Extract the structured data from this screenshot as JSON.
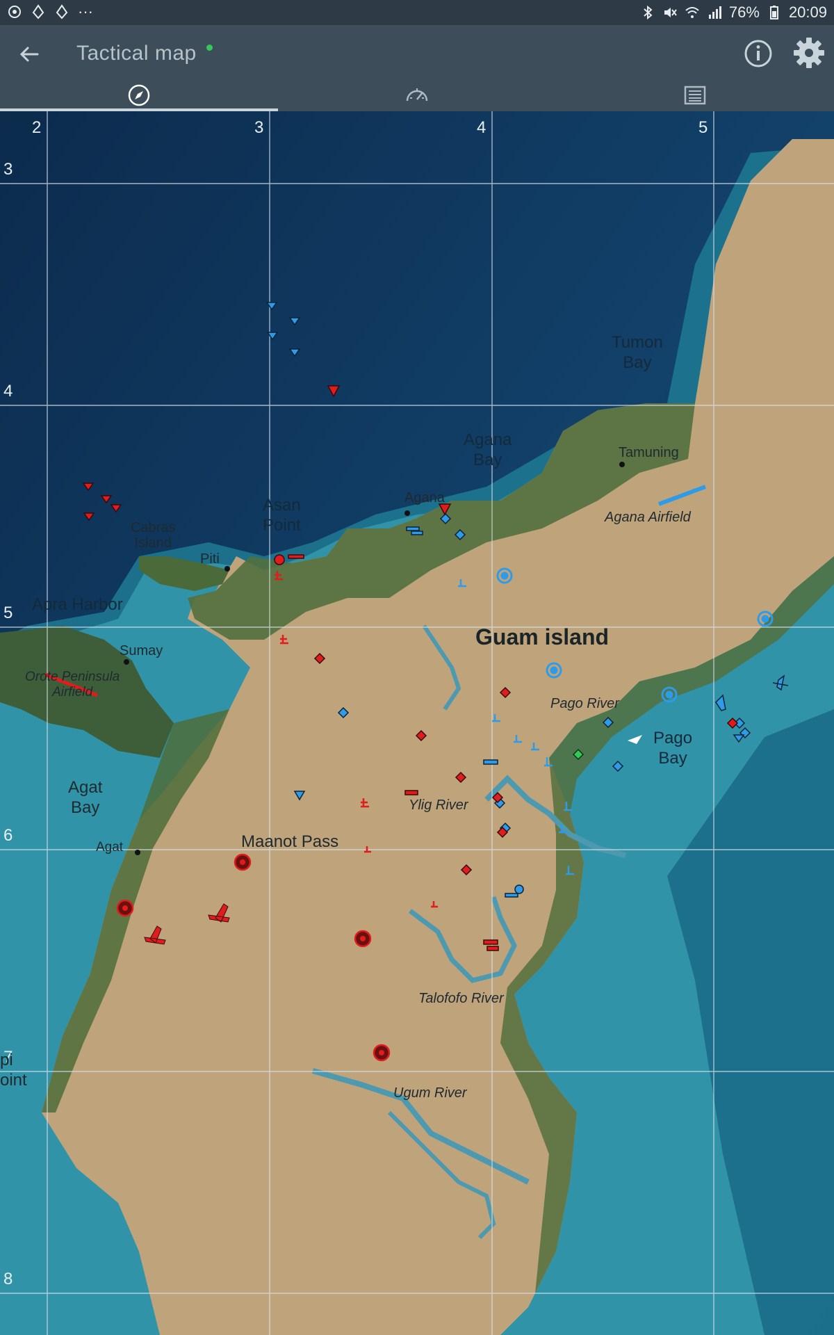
{
  "status_bar": {
    "battery": "76%",
    "time": "20:09",
    "overflow": "···",
    "left_icons": [
      "sync-icon",
      "app-icon",
      "app-icon"
    ],
    "right_icons": [
      "bluetooth-icon",
      "mute-icon",
      "wifi-icon",
      "signal-icon",
      "battery-icon"
    ]
  },
  "app_bar": {
    "title": "Tactical map",
    "status_dot_color": "#34c759",
    "actions": [
      "info-icon",
      "settings-gear-icon"
    ]
  },
  "tabs": [
    {
      "icon": "compass-icon",
      "selected": true
    },
    {
      "icon": "speedometer-icon",
      "selected": false
    },
    {
      "icon": "list-icon",
      "selected": false
    }
  ],
  "map": {
    "grid_columns": [
      "2",
      "3",
      "4",
      "5"
    ],
    "grid_rows": [
      "3",
      "4",
      "5",
      "6",
      "7",
      "8"
    ],
    "labels": {
      "tumon_bay": "Tumon\nBay",
      "agana_bay": "Agana\nBay",
      "tamuning": "Tamuning",
      "agana_airfield": "Agana Airfield",
      "asan_point": "Asan\nPoint",
      "agana": "Agana",
      "cabras_island": "Cabras\nIsland",
      "piti": "Piti",
      "apra_harbor": "Apra Harbor",
      "sumay": "Sumay",
      "orote_airfield": "Orote Peninsula\nAirfield",
      "guam_island": "Guam island",
      "pago_river": "Pago River",
      "pago_bay": "Pago\nBay",
      "agat_bay": "Agat\nBay",
      "agat": "Agat",
      "maanot_pass": "Maanot Pass",
      "ylig_river": "Ylig River",
      "talofofo_river": "Talofofo River",
      "ugum_river": "Ugum River",
      "pi_point": "pi\noint"
    },
    "team_colors": {
      "friendly": "#2e9be8",
      "enemy": "#e01c1c",
      "neutral": "#34c759"
    }
  }
}
